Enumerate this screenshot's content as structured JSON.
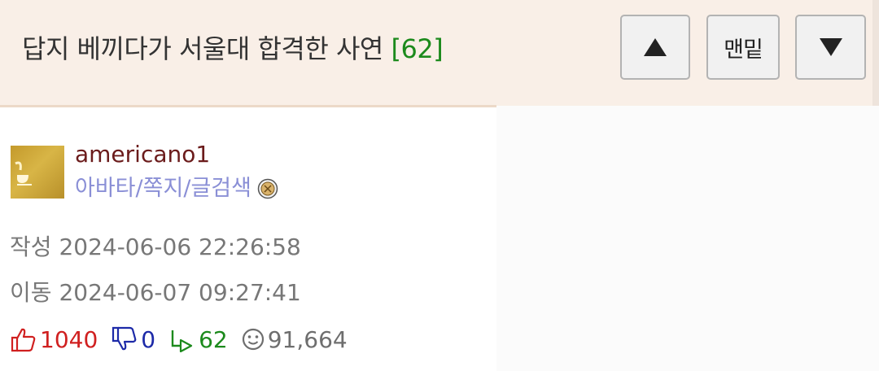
{
  "header": {
    "title": "답지 베끼다가 서울대 합격한 사연",
    "comment_count": "[62]",
    "buttons": {
      "up_icon": "triangle-up-icon",
      "bottom_label": "맨밑",
      "down_icon": "triangle-down-icon"
    }
  },
  "author": {
    "username": "americano1",
    "links": [
      "아바타",
      "쪽지",
      "글검색"
    ],
    "separator": "/",
    "avatar_icon": "coffee-cup-avatar",
    "badge_icon": "level-badge-icon"
  },
  "meta": {
    "created_label": "작성",
    "created_value": "2024-06-06 22:26:58",
    "moved_label": "이동",
    "moved_value": "2024-06-07 09:27:41"
  },
  "stats": {
    "upvotes": "1040",
    "downvotes": "0",
    "comments": "62",
    "views": "91,664"
  },
  "colors": {
    "header_bg": "#f9efe7",
    "username": "#6b1b1b",
    "links": "#8a8fd6",
    "upvote": "#d02020",
    "downvote": "#1d2aa8",
    "comments": "#1c8a1c"
  }
}
